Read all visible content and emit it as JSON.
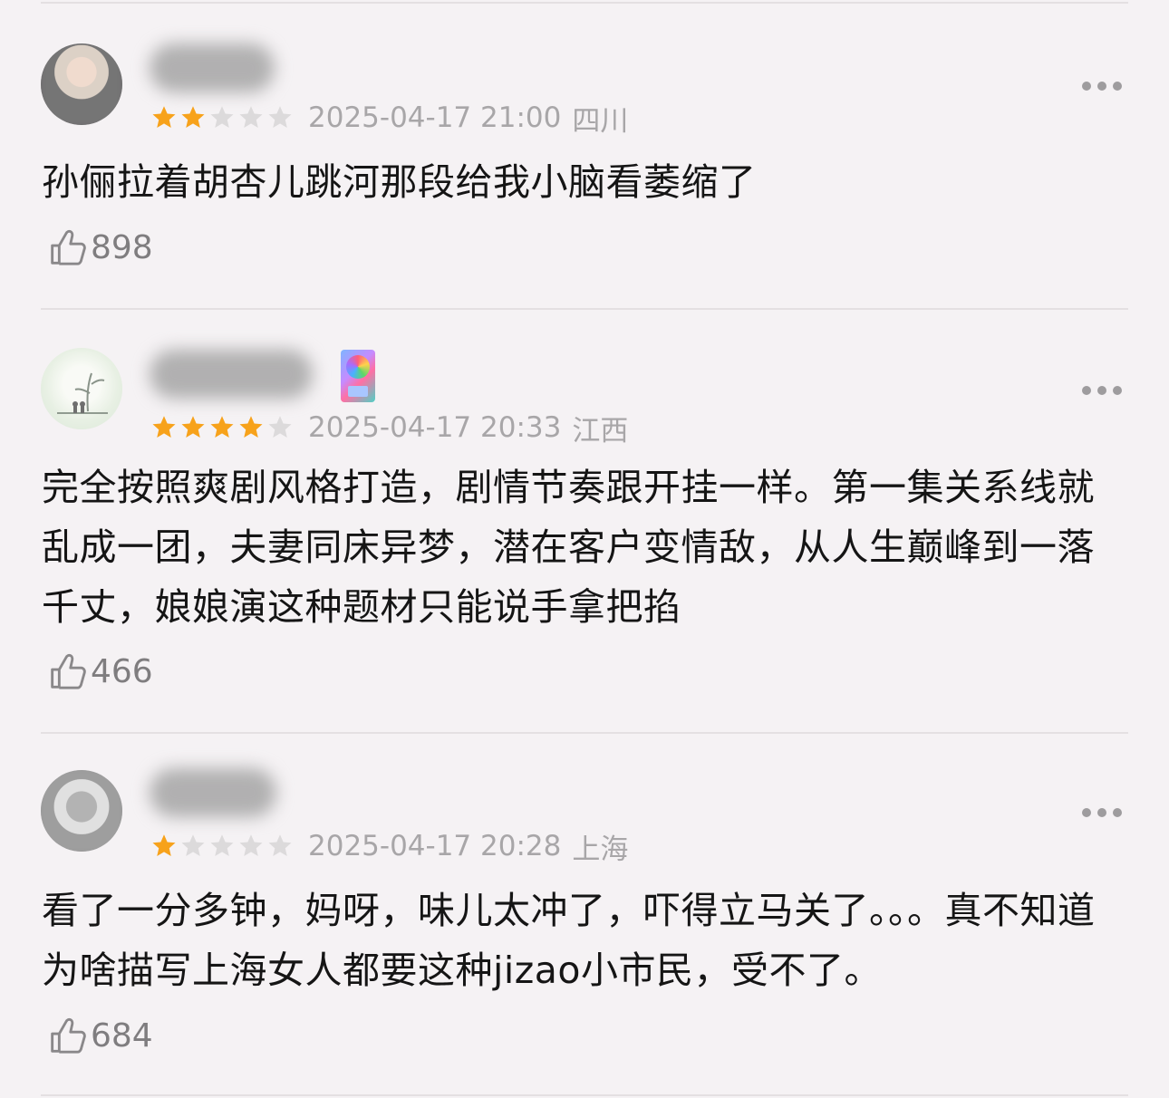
{
  "reviews": [
    {
      "rating": 2,
      "max_rating": 5,
      "date": "2025-04-17 21:00",
      "location": "四川",
      "text": "孙俪拉着胡杏儿跳河那段给我小脑看萎缩了",
      "likes": "898",
      "has_badge": false
    },
    {
      "rating": 4,
      "max_rating": 5,
      "date": "2025-04-17 20:33",
      "location": "江西",
      "text": "完全按照爽剧风格打造，剧情节奏跟开挂一样。第一集关系线就乱成一团，夫妻同床异梦，潜在客户变情敌，从人生巅峰到一落千丈，娘娘演这种题材只能说手拿把掐",
      "likes": "466",
      "has_badge": true
    },
    {
      "rating": 1,
      "max_rating": 5,
      "date": "2025-04-17 20:28",
      "location": "上海",
      "text": "看了一分多钟，妈呀，味儿太冲了，吓得立马关了。。。真不知道为啥描写上海女人都要这种jizao小市民，受不了。",
      "likes": "684",
      "has_badge": false
    }
  ],
  "colors": {
    "star_on": "#f7a21b",
    "star_off": "#dcdadb",
    "background": "#f5f2f4"
  },
  "icons": {
    "like": "thumbs-up-icon",
    "more": "more-dots-icon",
    "star": "star-icon"
  }
}
